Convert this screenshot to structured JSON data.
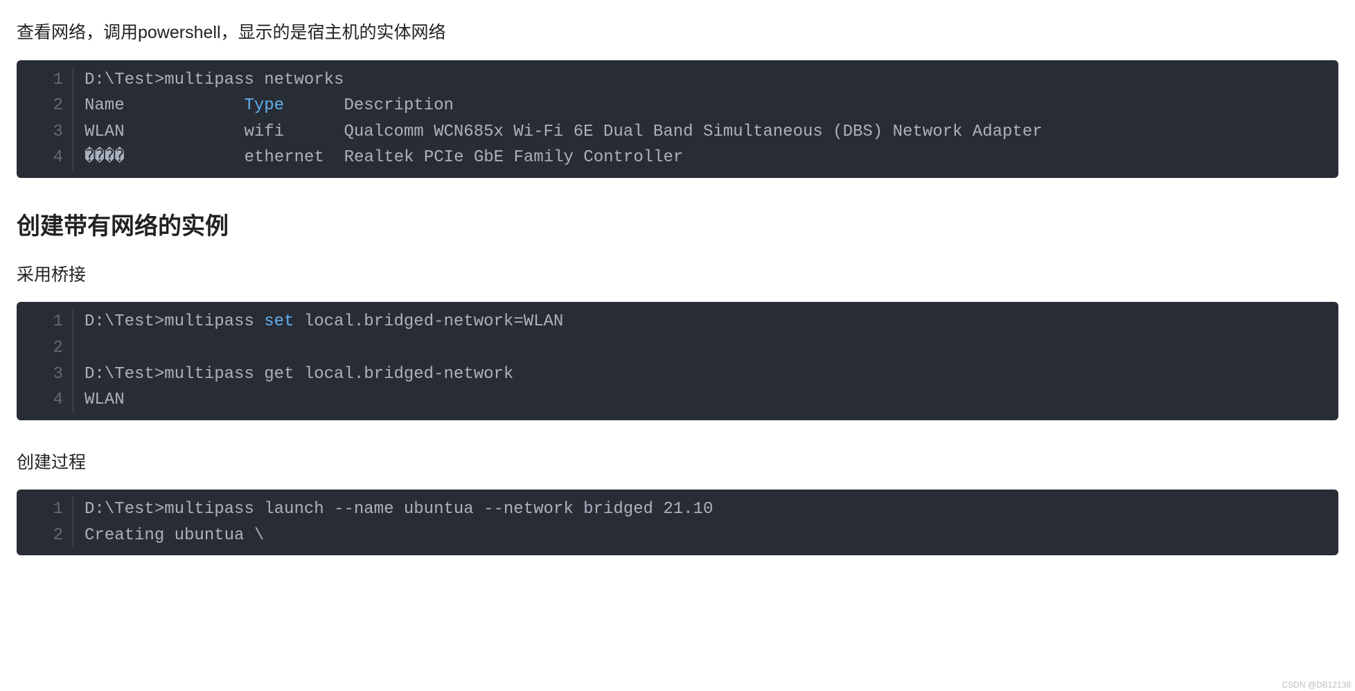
{
  "para1": "查看网络，调用powershell，显示的是宿主机的实体网络",
  "block1": {
    "lines": [
      [
        {
          "t": "D:\\Test>multipass networks",
          "c": "tok-plain"
        }
      ],
      [
        {
          "t": "Name            ",
          "c": "tok-plain"
        },
        {
          "t": "Type",
          "c": "tok-keyword"
        },
        {
          "t": "      Description",
          "c": "tok-plain"
        }
      ],
      [
        {
          "t": "WLAN            wifi      Qualcomm WCN685x Wi-Fi 6E Dual Band Simultaneous (DBS) Network Adapter",
          "c": "tok-plain"
        }
      ],
      [
        {
          "t": "����            ethernet  Realtek PCIe GbE Family Controller",
          "c": "tok-plain"
        }
      ]
    ]
  },
  "heading1": "创建带有网络的实例",
  "para2": "采用桥接",
  "block2": {
    "lines": [
      [
        {
          "t": "D:\\Test>multipass ",
          "c": "tok-plain"
        },
        {
          "t": "set",
          "c": "tok-keyword"
        },
        {
          "t": " local.bridged-network=WLAN",
          "c": "tok-plain"
        }
      ],
      [
        {
          "t": "",
          "c": "tok-plain"
        }
      ],
      [
        {
          "t": "D:\\Test>multipass get local.bridged-network",
          "c": "tok-plain"
        }
      ],
      [
        {
          "t": "WLAN",
          "c": "tok-plain"
        }
      ]
    ]
  },
  "para3": "创建过程",
  "block3": {
    "lines": [
      [
        {
          "t": "D:\\Test>multipass launch --name ubuntua --network bridged 21.10",
          "c": "tok-plain"
        }
      ],
      [
        {
          "t": "Creating ubuntua \\",
          "c": "tok-plain"
        }
      ]
    ]
  },
  "watermark": "CSDN @DB12138"
}
